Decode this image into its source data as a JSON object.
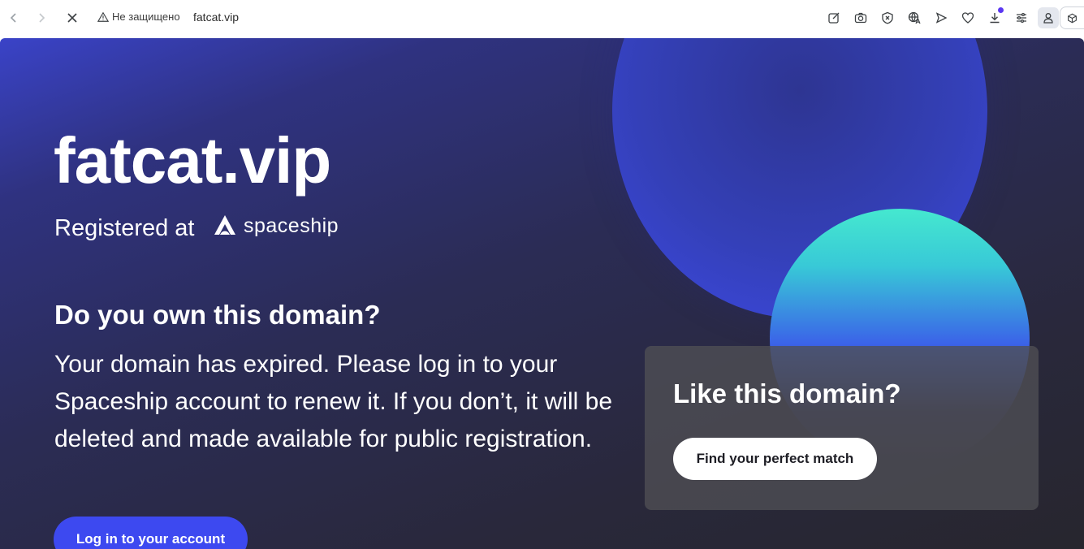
{
  "browser": {
    "security_label": "Не защищено",
    "url": "fatcat.vip",
    "icons": [
      "back-icon",
      "forward-icon",
      "stop-icon",
      "warning-icon",
      "edit-icon",
      "camera-icon",
      "shield-x-icon",
      "translate-icon",
      "send-icon",
      "heart-icon",
      "download-icon",
      "settings-icon",
      "profile-icon",
      "cube-icon"
    ]
  },
  "hero": {
    "domain": "fatcat.vip",
    "registered_label": "Registered at",
    "registrar": "spaceship"
  },
  "owner": {
    "heading": "Do you own this domain?",
    "message": "Your domain has expired. Please log in to your Spaceship account to renew it. If you don’t, it will be deleted and made available for public registration.",
    "login_label": "Log in to your account"
  },
  "card": {
    "title": "Like this domain?",
    "button_label": "Find your perfect match"
  },
  "colors": {
    "accent": "#3d49f0",
    "teal": "#45e8cf",
    "background": "#29283b"
  }
}
